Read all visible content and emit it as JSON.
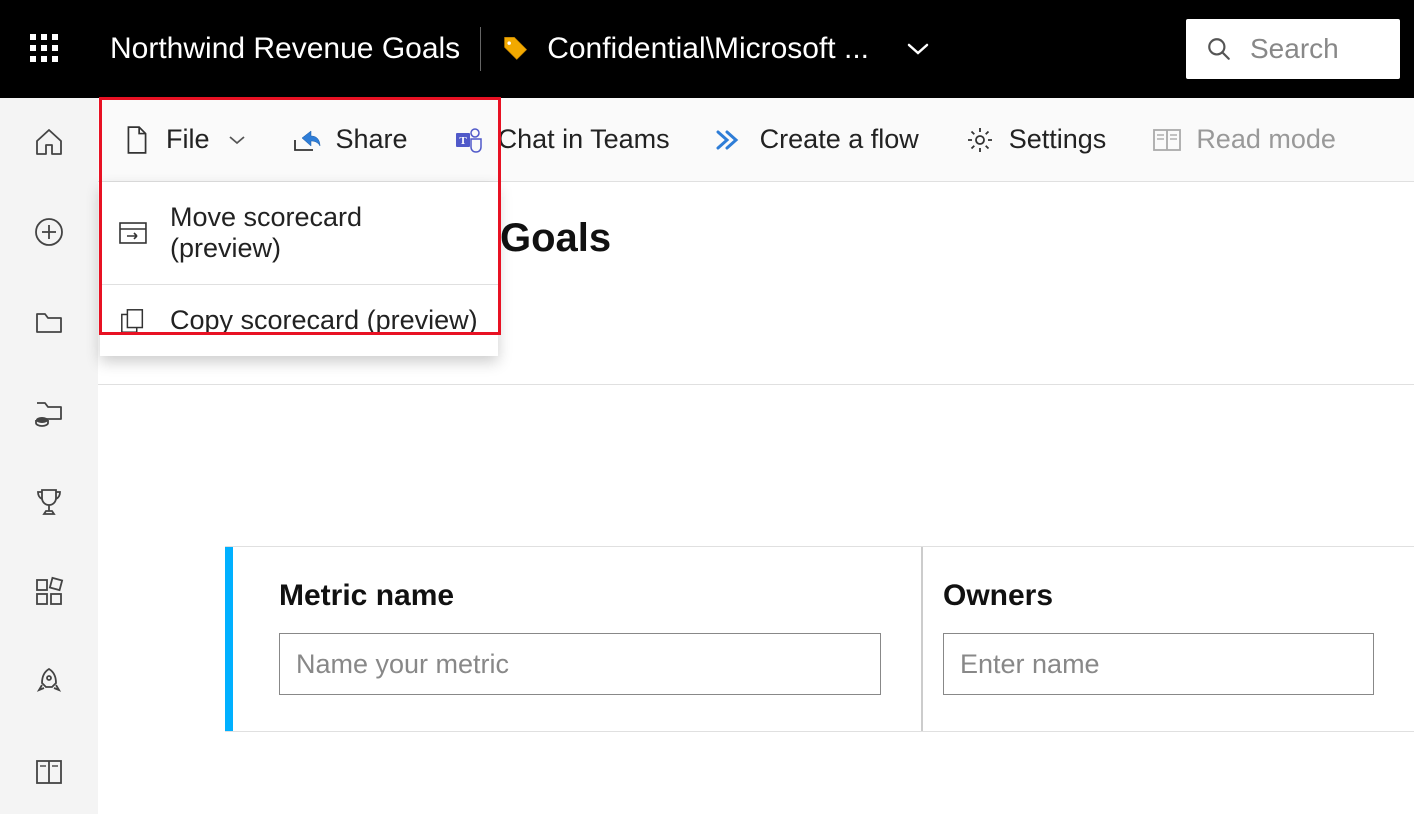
{
  "header": {
    "title": "Northwind Revenue Goals",
    "sensitivity_label": "Confidential\\Microsoft ...",
    "search_placeholder": "Search"
  },
  "toolbar": {
    "file_label": "File",
    "share_label": "Share",
    "chat_in_teams_label": "Chat in Teams",
    "create_flow_label": "Create a flow",
    "settings_label": "Settings",
    "read_mode_label": "Read mode"
  },
  "file_menu": {
    "move_label": "Move scorecard (preview)",
    "copy_label": "Copy scorecard (preview)"
  },
  "page": {
    "title_partial": "Goals"
  },
  "metric_form": {
    "metric_name_label": "Metric name",
    "metric_name_placeholder": "Name your metric",
    "owners_label": "Owners",
    "owners_placeholder": "Enter name"
  },
  "colors": {
    "accent": "#00b0ff",
    "highlight": "#e81123",
    "tag": "#f2a900"
  }
}
